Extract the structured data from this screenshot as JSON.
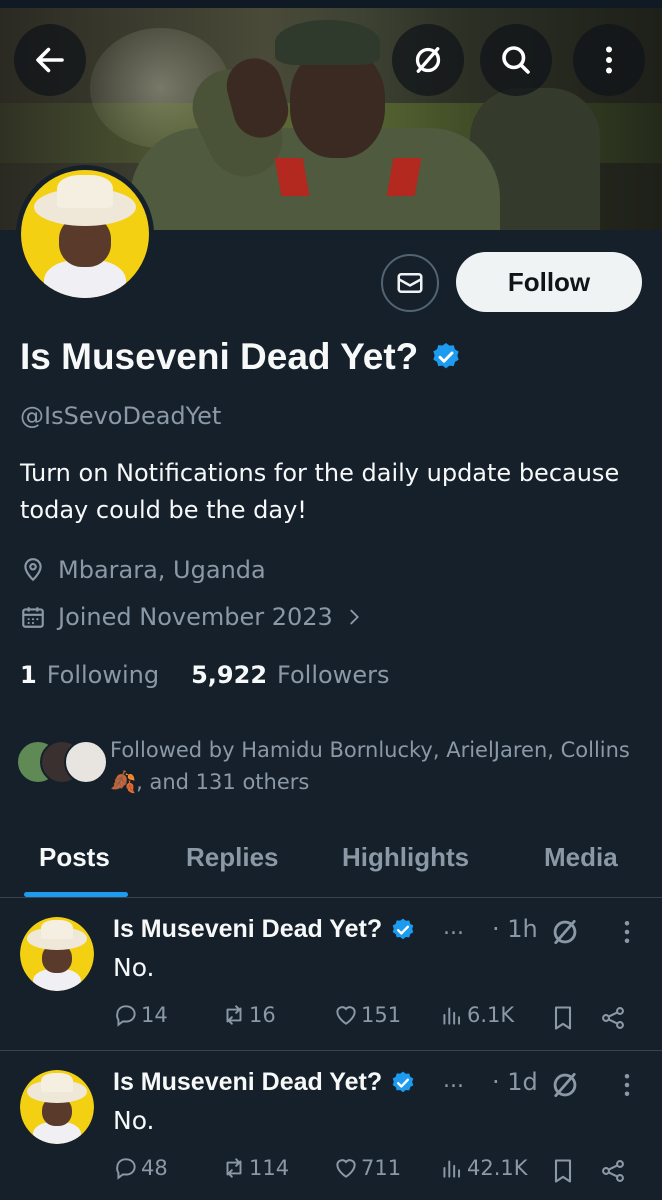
{
  "header": {
    "back_icon": "arrow-left-icon",
    "grok_icon": "slash-circle-icon",
    "search_icon": "search-icon",
    "more_icon": "more-vertical-icon"
  },
  "profile": {
    "name": "Is Museveni Dead Yet?",
    "handle": "@IsSevoDeadYet",
    "bio": "Turn on Notifications for the daily update because today could be the day!",
    "location": "Mbarara, Uganda",
    "joined": "Joined November 2023",
    "following_count": "1",
    "following_label": "Following",
    "followers_count": "5,922",
    "followers_label": "Followers",
    "followed_by": "Followed by Hamidu Bornlucky, ArielJaren, Collins🍂, and 131 others",
    "follow_label": "Follow",
    "accent_color": "#1d9bf0"
  },
  "tabs": [
    {
      "label": "Posts"
    },
    {
      "label": "Replies"
    },
    {
      "label": "Highlights"
    },
    {
      "label": "Media"
    }
  ],
  "posts": [
    {
      "name": "Is Museveni Dead Yet?",
      "trunc": "...",
      "time": "· 1h",
      "text": "No.",
      "replies": "14",
      "reposts": "16",
      "likes": "151",
      "views": "6.1K"
    },
    {
      "name": "Is Museveni Dead Yet?",
      "trunc": "...",
      "time": "· 1d",
      "text": "No.",
      "replies": "48",
      "reposts": "114",
      "likes": "711",
      "views": "42.1K"
    }
  ]
}
